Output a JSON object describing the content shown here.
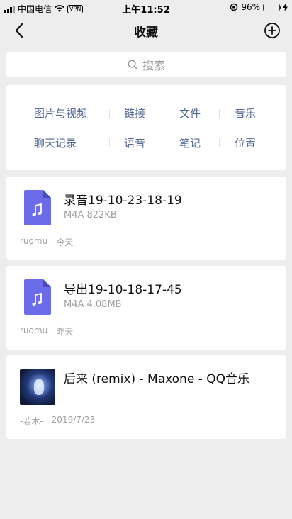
{
  "status_bar": {
    "carrier": "中国电信",
    "vpn": "VPN",
    "time": "上午11:52",
    "battery_percent": "96%",
    "battery_level": 0.96
  },
  "nav": {
    "title": "收藏",
    "back_icon": "chevron-left-icon",
    "add_icon": "plus-circle-icon"
  },
  "search": {
    "placeholder": "搜索",
    "icon": "search-icon"
  },
  "categories": {
    "row1": [
      "图片与视频",
      "链接",
      "文件",
      "音乐"
    ],
    "row2": [
      "聊天记录",
      "语音",
      "笔记",
      "位置"
    ]
  },
  "items": [
    {
      "title": "录音19-10-23-18-19",
      "subtitle": "M4A 822KB",
      "source": "ruomu",
      "date": "今天",
      "icon": "music-file-icon"
    },
    {
      "title": "导出19-10-18-17-45",
      "subtitle": "M4A 4.08MB",
      "source": "ruomu",
      "date": "昨天",
      "icon": "music-file-icon"
    },
    {
      "title": "后来 (remix) - Maxone - QQ音乐",
      "subtitle": "",
      "source": "-若木-",
      "date": "2019/7/23",
      "icon": "album-thumbnail"
    }
  ],
  "colors": {
    "link": "#576b95",
    "file_icon": "#6c6bea",
    "background": "#ededed"
  }
}
